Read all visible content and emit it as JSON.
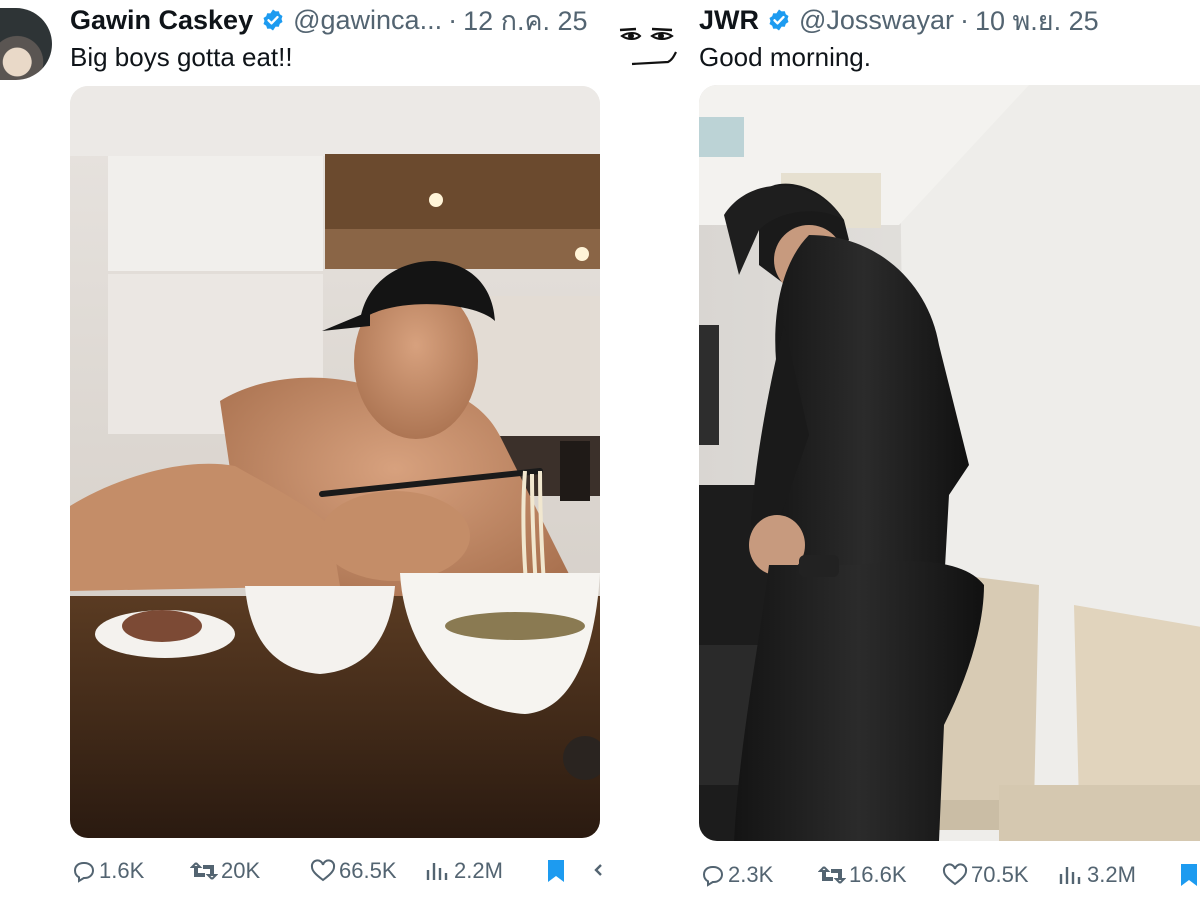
{
  "tweets": [
    {
      "name": "Gawin Caskey",
      "handle": "@gawinca...",
      "separator": "·",
      "date": "12 ก.ค. 25",
      "text": "Big boys gotta eat!!",
      "verified": true,
      "avatar_icon": "profile-photo",
      "media_description_icon": "photo-shirtless-man-eating-noodles",
      "stats": {
        "replies": "1.6K",
        "reposts": "20K",
        "likes": "66.5K",
        "views": "2.2M"
      }
    },
    {
      "name": "JWR",
      "handle": "@Josswayar",
      "separator": "·",
      "date": "10 พ.ย. 25",
      "text": "Good morning.",
      "verified": true,
      "avatar_icon": "meme-face-avatar",
      "media_description_icon": "photo-man-in-black-compression-wear",
      "stats": {
        "replies": "2.3K",
        "reposts": "16.6K",
        "likes": "70.5K",
        "views": "3.2M"
      }
    }
  ],
  "colors": {
    "verified": "#1d9bf0",
    "bookmark": "#1d9bf0",
    "secondary_text": "#536471",
    "primary_text": "#0f1419"
  }
}
